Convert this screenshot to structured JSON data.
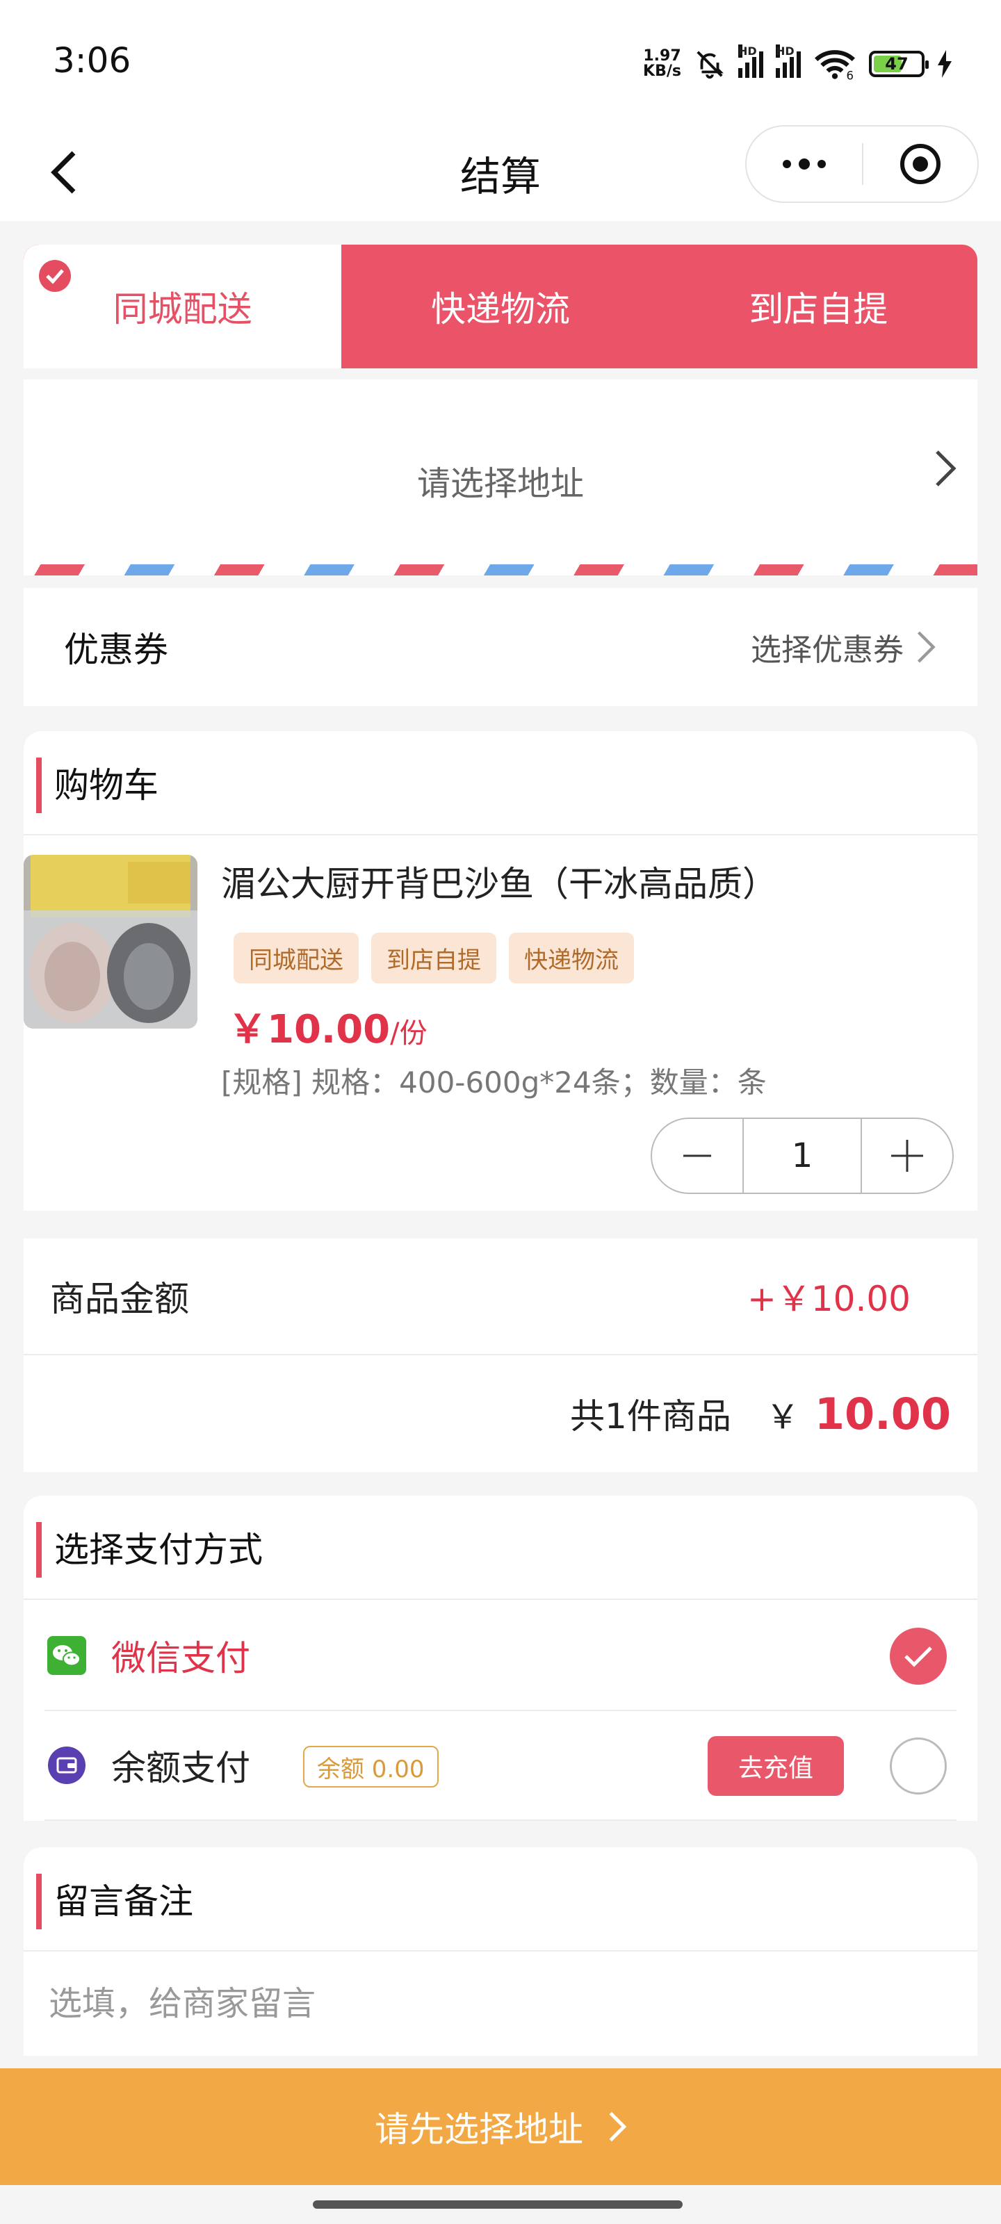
{
  "status_bar": {
    "time": "3:06",
    "net_speed_value": "1.97",
    "net_speed_unit": "KB/s",
    "sim1_tag": "HD",
    "sim2_tag": "HD",
    "wifi_tag": "6",
    "battery": "47",
    "icons": [
      "mute-bell-icon",
      "signal-icon",
      "signal-icon",
      "wifi-icon",
      "battery-icon",
      "charging-icon"
    ]
  },
  "nav": {
    "title": "结算",
    "back_icon": "chevron-left-icon",
    "more_icon": "more-dots-icon",
    "close_icon": "target-close-icon"
  },
  "delivery_tabs": [
    {
      "label": "同城配送",
      "active": true
    },
    {
      "label": "快递物流",
      "active": false
    },
    {
      "label": "到店自提",
      "active": false
    }
  ],
  "address": {
    "placeholder": "请选择地址"
  },
  "coupon": {
    "label": "优惠券",
    "value": "选择优惠券"
  },
  "cart": {
    "title": "购物车",
    "items": [
      {
        "name": "湄公大厨开背巴沙鱼（干冰高品质）",
        "tags": [
          "同城配送",
          "到店自提",
          "快递物流"
        ],
        "price": "￥10.00",
        "price_unit": "/份",
        "spec": "[规格] 规格：400-600g*24条；数量：条",
        "quantity": "1"
      }
    ]
  },
  "amount": {
    "goods_label": "商品金额",
    "goods_value": "+￥10.00",
    "total_count": "共1件商品",
    "total_currency": "￥",
    "total_value": "10.00"
  },
  "payment": {
    "title": "选择支付方式",
    "methods": [
      {
        "name": "微信支付",
        "icon": "wechat-pay-icon",
        "selected": true
      },
      {
        "name": "余额支付",
        "icon": "wallet-icon",
        "balance": "余额 0.00",
        "action": "去充值",
        "selected": false
      }
    ]
  },
  "remark": {
    "title": "留言备注",
    "placeholder": "选填，给商家留言"
  },
  "submit": {
    "label": "请先选择地址"
  },
  "colors": {
    "accent_red": "#e8586a",
    "price_red": "#e0334a",
    "submit_orange": "#f2a945",
    "tag_bg": "#fbe6d6"
  }
}
